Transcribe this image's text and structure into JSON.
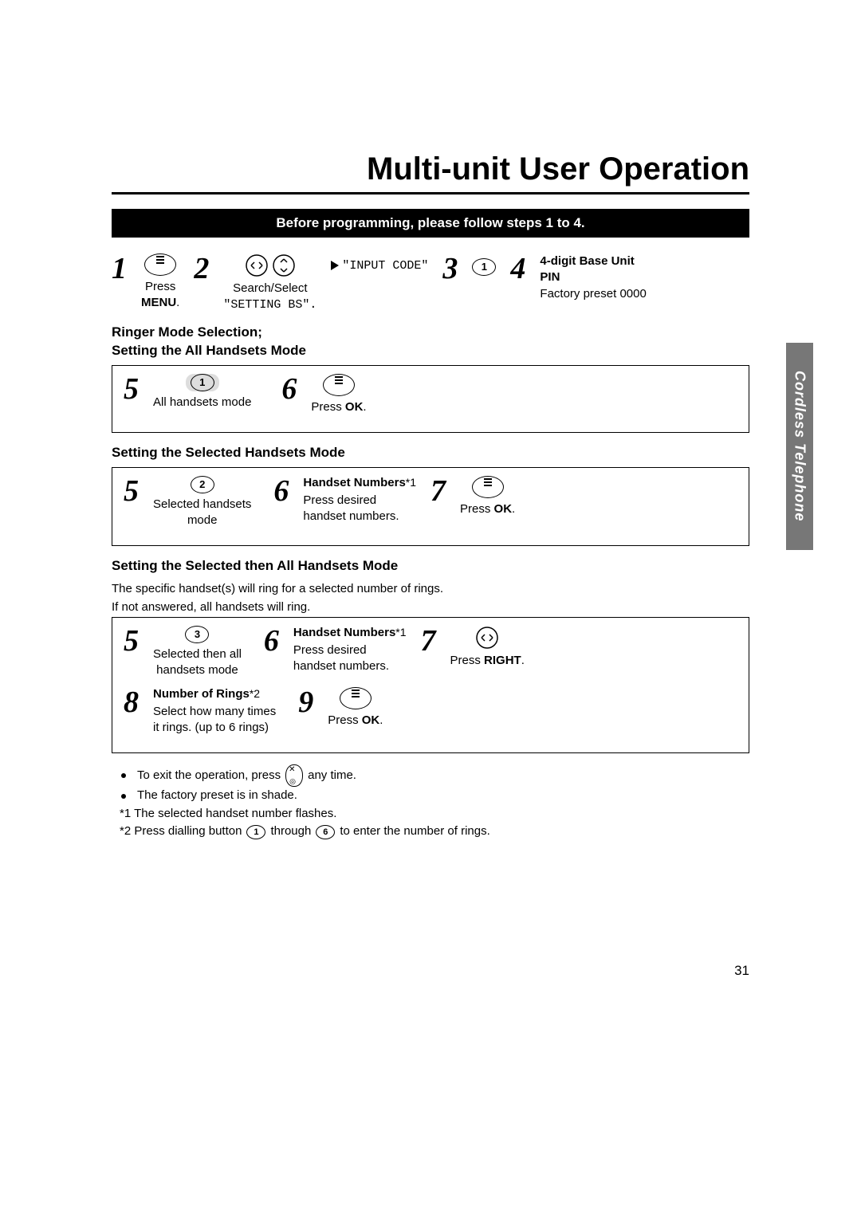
{
  "title": "Multi-unit User Operation",
  "banner": "Before programming, please follow steps 1 to 4.",
  "side_tab": "Cordless Telephone",
  "page_number": "31",
  "pre": {
    "s1": {
      "label_a": "Press",
      "label_b": "MENU"
    },
    "s2": {
      "sub": "Search/Select",
      "mono": "\"SETTING BS\"."
    },
    "input_code": "\"INPUT CODE\"",
    "s3_key": "1",
    "s4_line1": "4-digit Base Unit",
    "s4_line2": "PIN",
    "s4_line3": "Factory preset 0000"
  },
  "sectionA": {
    "heading_line1": "Ringer Mode Selection;",
    "heading_line2": "Setting the All Handsets Mode",
    "s5": {
      "key": "1",
      "label": "All handsets mode"
    },
    "s6": {
      "label_a": "Press ",
      "label_b": "OK"
    }
  },
  "sectionB": {
    "heading": "Setting the Selected Handsets Mode",
    "s5": {
      "key": "2",
      "label_a": "Selected handsets",
      "label_b": "mode"
    },
    "s6": {
      "title_a": "Handset Numbers",
      "title_b": "*1",
      "sub_a": "Press desired",
      "sub_b": "handset numbers."
    },
    "s7": {
      "label_a": "Press ",
      "label_b": "OK"
    }
  },
  "sectionC": {
    "heading": "Setting the Selected then All Handsets Mode",
    "desc_a": "The specific handset(s) will ring for a selected number of rings.",
    "desc_b": "If not answered, all handsets will ring.",
    "s5": {
      "key": "3",
      "label_a": "Selected then all",
      "label_b": "handsets mode"
    },
    "s6": {
      "title_a": "Handset Numbers",
      "title_b": "*1",
      "sub_a": "Press desired",
      "sub_b": "handset numbers."
    },
    "s7": {
      "label_a": "Press ",
      "label_b": "RIGHT"
    },
    "s8": {
      "title_a": "Number of Rings",
      "title_b": "*2",
      "sub_a": "Select how many times",
      "sub_b": "it rings. (up to 6 rings)"
    },
    "s9": {
      "label_a": "Press ",
      "label_b": "OK"
    }
  },
  "notes": {
    "n1_a": "To exit the operation, press ",
    "n1_b": " any time.",
    "n2": "The factory preset is in shade.",
    "n3": "*1 The selected handset number flashes.",
    "n4_a": "*2 Press dialling button ",
    "n4_key1": "1",
    "n4_mid": " through ",
    "n4_key2": "6",
    "n4_b": " to enter the number of rings."
  }
}
